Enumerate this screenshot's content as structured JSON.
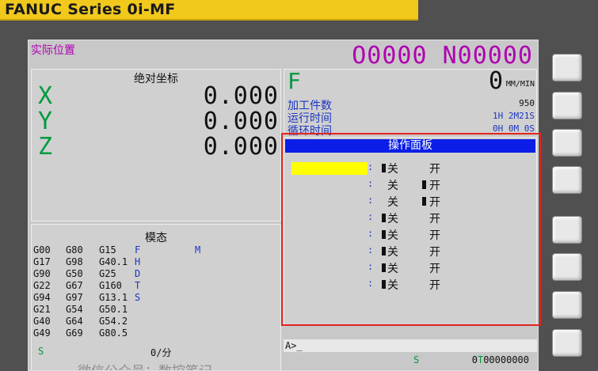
{
  "brand": {
    "text": "FANUC Series 0i-MF"
  },
  "screen": {
    "title": "实际位置",
    "program": "O0000 N00000"
  },
  "absolute": {
    "title": "绝对坐标",
    "axes": [
      {
        "name": "X",
        "value": "0.000"
      },
      {
        "name": "Y",
        "value": "0.000"
      },
      {
        "name": "Z",
        "value": "0.000"
      }
    ]
  },
  "feed": {
    "label": "F",
    "value": "0",
    "unit": "MM/MIN",
    "rows": [
      {
        "label": "加工件数",
        "value": "950"
      },
      {
        "label": "运行时间",
        "value": "1H 2M21S"
      },
      {
        "label": "循环时间",
        "value": "0H 0M 0S"
      }
    ]
  },
  "operator_panel": {
    "title": "操作面板",
    "off_label": "关",
    "on_label": "开",
    "colon": ":",
    "rows": [
      {
        "state": "off",
        "selected": true
      },
      {
        "state": "on",
        "selected": false
      },
      {
        "state": "on",
        "selected": false
      },
      {
        "state": "off",
        "selected": false
      },
      {
        "state": "off",
        "selected": false
      },
      {
        "state": "off",
        "selected": false
      },
      {
        "state": "off",
        "selected": false
      },
      {
        "state": "off",
        "selected": false
      }
    ]
  },
  "modal": {
    "title": "模态",
    "rows": [
      [
        "G00",
        "G80",
        "G15"
      ],
      [
        "G17",
        "G98",
        "G40.1"
      ],
      [
        "G90",
        "G50",
        "G25"
      ],
      [
        "G22",
        "G67",
        "G160"
      ],
      [
        "G94",
        "G97",
        "G13.1"
      ],
      [
        "G21",
        "G54",
        "G50.1"
      ],
      [
        "G40",
        "G64",
        "G54.2"
      ],
      [
        "G49",
        "G69",
        "G80.5"
      ]
    ],
    "letters": [
      "F",
      "H",
      "D",
      "T",
      "S"
    ],
    "m_label": "M",
    "s_label": "S",
    "rate": "0/分"
  },
  "command": {
    "prompt": "A>_"
  },
  "status": {
    "s": "S",
    "t_prefix": "0",
    "t": "T",
    "t_value": "00000000"
  },
  "watermark": "微信公众号：数控笔记",
  "colors": {
    "magenta": "#b000b0",
    "green": "#009a3c",
    "blue": "#1c35c0",
    "header_blue": "#0a1ee8",
    "highlight_yellow": "#ffff00",
    "frame_red": "#e2261d",
    "brand_yellow": "#f1c81c"
  }
}
